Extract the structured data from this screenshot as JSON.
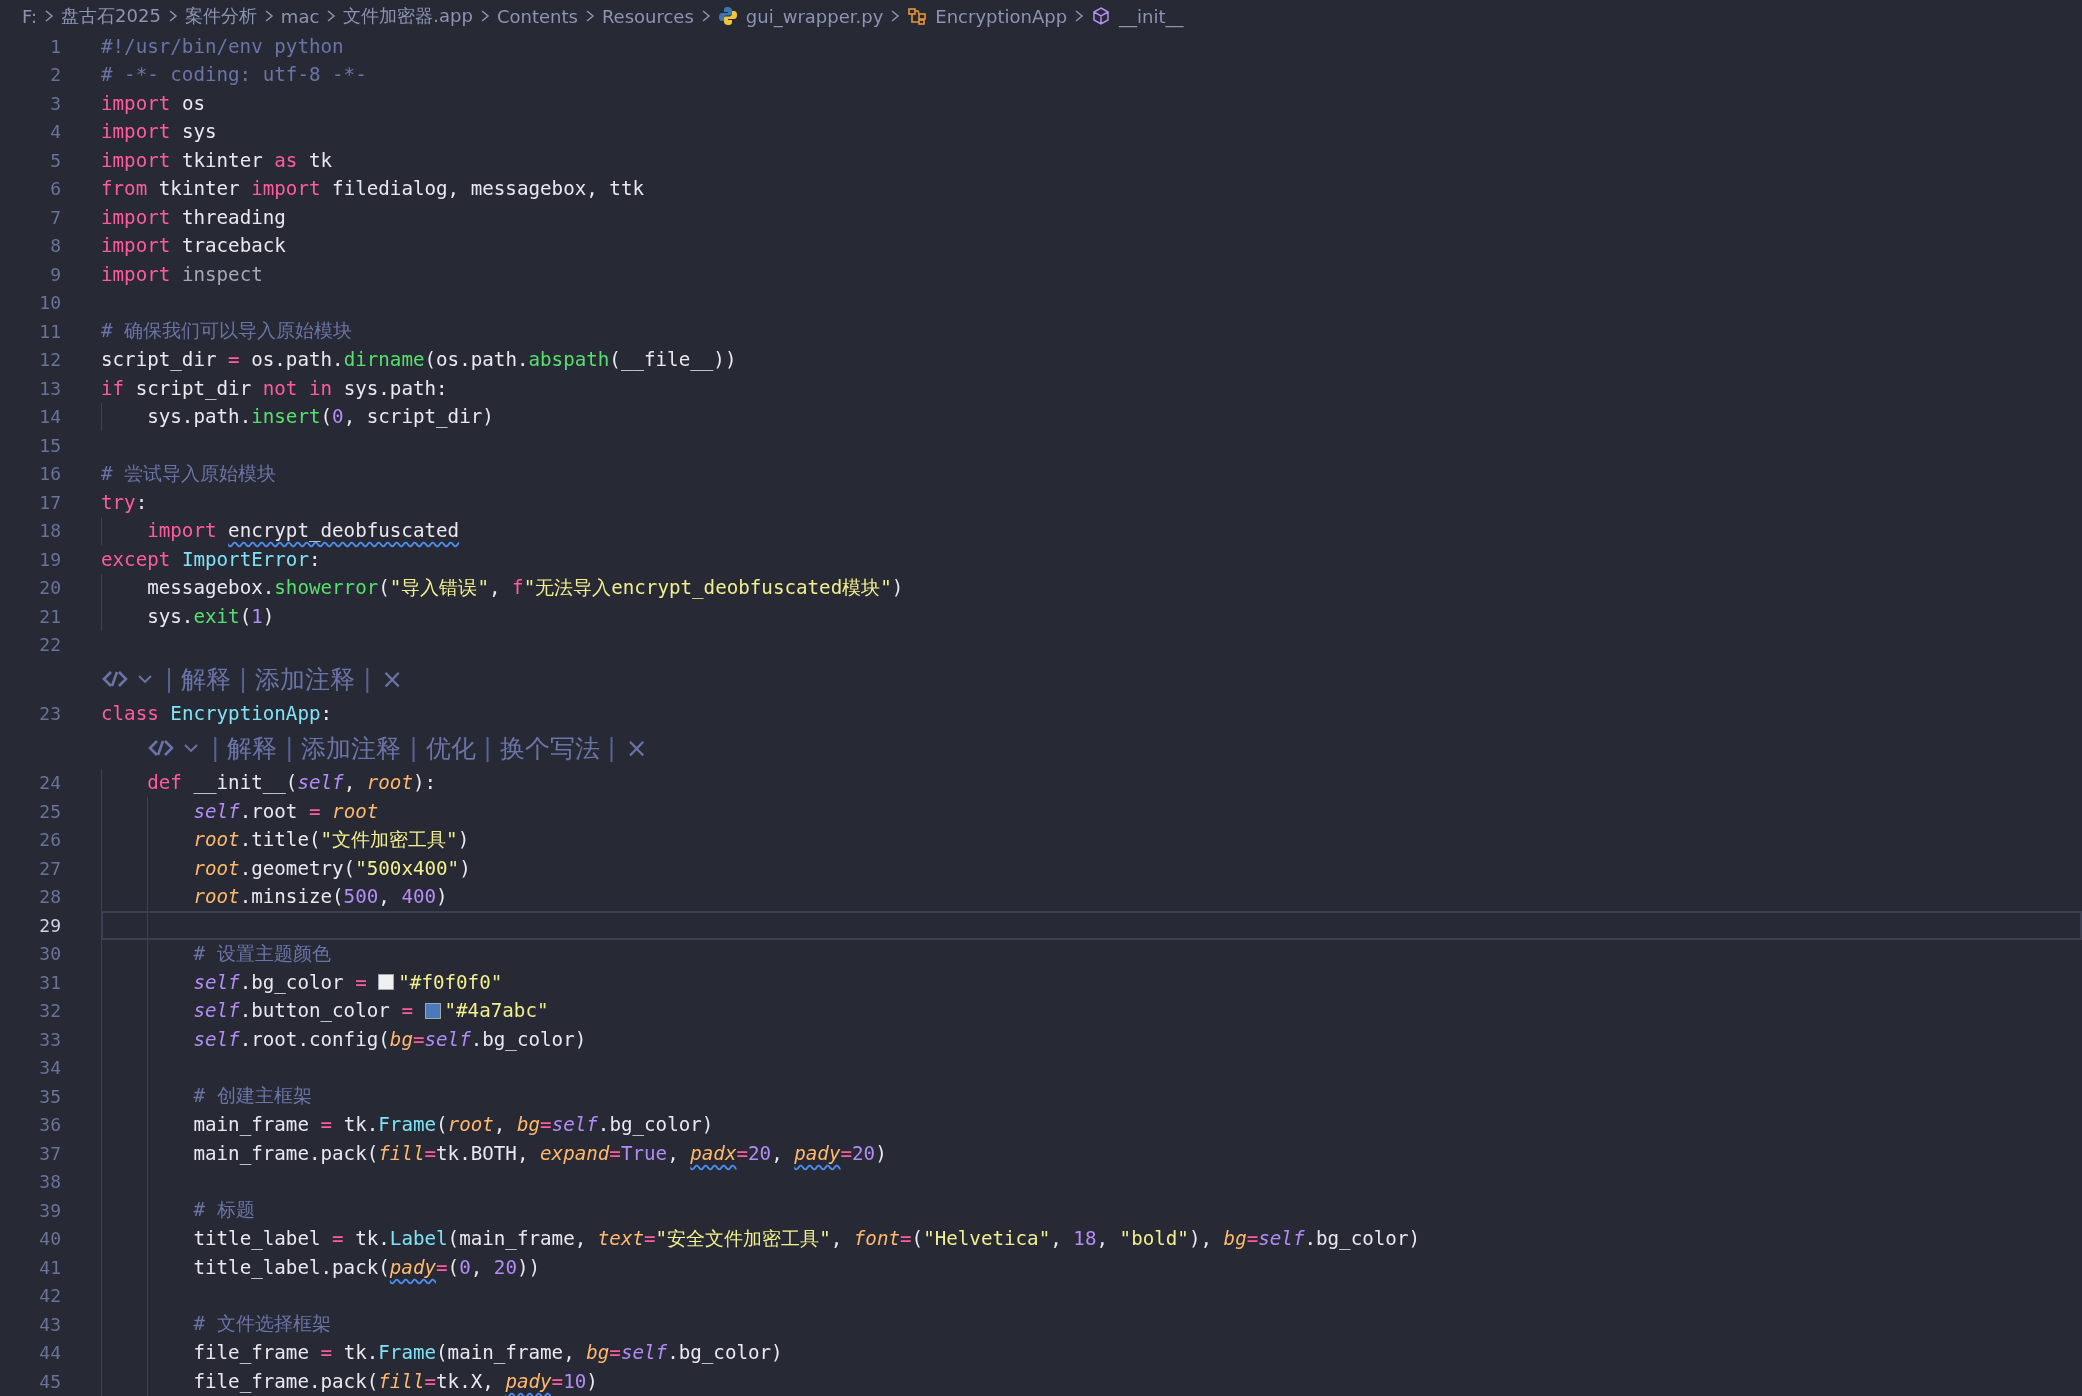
{
  "breadcrumb": [
    {
      "kind": "text",
      "text": "F:"
    },
    {
      "kind": "text",
      "text": "盘古石2025"
    },
    {
      "kind": "text",
      "text": "案件分析"
    },
    {
      "kind": "text",
      "text": "mac"
    },
    {
      "kind": "text",
      "text": "文件加密器.app"
    },
    {
      "kind": "text",
      "text": "Contents"
    },
    {
      "kind": "text",
      "text": "Resources"
    },
    {
      "kind": "python",
      "text": "gui_wrapper.py"
    },
    {
      "kind": "class",
      "text": "EncryptionApp"
    },
    {
      "kind": "method",
      "text": "__init__"
    }
  ],
  "lines": [
    {
      "kind": "code",
      "number": "1",
      "current": false,
      "tokens": [
        {
          "kind": "comment",
          "text": "#!/usr/bin/env python"
        }
      ]
    },
    {
      "kind": "code",
      "number": "2",
      "current": false,
      "tokens": [
        {
          "kind": "comment",
          "text": "# -*- coding: utf-8 -*-"
        }
      ]
    },
    {
      "kind": "code",
      "number": "3",
      "current": false,
      "tokens": [
        {
          "kind": "kw",
          "text": "import"
        },
        {
          "kind": "plain",
          "text": " os"
        }
      ]
    },
    {
      "kind": "code",
      "number": "4",
      "current": false,
      "tokens": [
        {
          "kind": "kw",
          "text": "import"
        },
        {
          "kind": "plain",
          "text": " sys"
        }
      ]
    },
    {
      "kind": "code",
      "number": "5",
      "current": false,
      "tokens": [
        {
          "kind": "kw",
          "text": "import"
        },
        {
          "kind": "plain",
          "text": " tkinter "
        },
        {
          "kind": "kw",
          "text": "as"
        },
        {
          "kind": "plain",
          "text": " tk"
        }
      ]
    },
    {
      "kind": "code",
      "number": "6",
      "current": false,
      "tokens": [
        {
          "kind": "kw",
          "text": "from"
        },
        {
          "kind": "plain",
          "text": " tkinter "
        },
        {
          "kind": "kw",
          "text": "import"
        },
        {
          "kind": "plain",
          "text": " filedialog, messagebox, ttk"
        }
      ]
    },
    {
      "kind": "code",
      "number": "7",
      "current": false,
      "tokens": [
        {
          "kind": "kw",
          "text": "import"
        },
        {
          "kind": "plain",
          "text": " threading"
        }
      ]
    },
    {
      "kind": "code",
      "number": "8",
      "current": false,
      "tokens": [
        {
          "kind": "kw",
          "text": "import"
        },
        {
          "kind": "plain",
          "text": " traceback"
        }
      ]
    },
    {
      "kind": "code",
      "number": "9",
      "current": false,
      "tokens": [
        {
          "kind": "kw",
          "text": "import"
        },
        {
          "kind": "dim",
          "text": " inspect"
        }
      ]
    },
    {
      "kind": "code",
      "number": "10",
      "current": false
    },
    {
      "kind": "code",
      "number": "11",
      "current": false,
      "tokens": [
        {
          "kind": "comment",
          "text": "# 确保我们可以导入原始模块"
        }
      ]
    },
    {
      "kind": "code",
      "number": "12",
      "current": false,
      "tokens": [
        {
          "kind": "plain",
          "text": "script_dir "
        },
        {
          "kind": "kw",
          "text": "="
        },
        {
          "kind": "plain",
          "text": " os.path."
        },
        {
          "kind": "fn",
          "text": "dirname"
        },
        {
          "kind": "plain",
          "text": "(os.path."
        },
        {
          "kind": "fn",
          "text": "abspath"
        },
        {
          "kind": "plain",
          "text": "(__file__))"
        }
      ]
    },
    {
      "kind": "code",
      "number": "13",
      "current": false,
      "tokens": [
        {
          "kind": "kw",
          "text": "if"
        },
        {
          "kind": "plain",
          "text": " script_dir "
        },
        {
          "kind": "kw",
          "text": "not in"
        },
        {
          "kind": "plain",
          "text": " sys.path:"
        }
      ]
    },
    {
      "kind": "code",
      "number": "14",
      "current": false,
      "tokens": [
        {
          "kind": "plain",
          "text": "    sys.path."
        },
        {
          "kind": "fn",
          "text": "insert"
        },
        {
          "kind": "plain",
          "text": "("
        },
        {
          "kind": "num",
          "text": "0"
        },
        {
          "kind": "plain",
          "text": ", script_dir)"
        }
      ]
    },
    {
      "kind": "code",
      "number": "15",
      "current": false
    },
    {
      "kind": "code",
      "number": "16",
      "current": false,
      "tokens": [
        {
          "kind": "comment",
          "text": "# 尝试导入原始模块"
        }
      ]
    },
    {
      "kind": "code",
      "number": "17",
      "current": false,
      "tokens": [
        {
          "kind": "kw",
          "text": "try"
        },
        {
          "kind": "plain",
          "text": ":"
        }
      ]
    },
    {
      "kind": "code",
      "number": "18",
      "current": false,
      "tokens": [
        {
          "kind": "kw",
          "text": "    import "
        },
        {
          "kind": "plain",
          "text": "encrypt_deobfuscated",
          "squiggle": true
        }
      ]
    },
    {
      "kind": "code",
      "number": "19",
      "current": false,
      "tokens": [
        {
          "kind": "kw",
          "text": "except "
        },
        {
          "kind": "cls",
          "text": "ImportError"
        },
        {
          "kind": "plain",
          "text": ":"
        }
      ]
    },
    {
      "kind": "code",
      "number": "20",
      "current": false,
      "tokens": [
        {
          "kind": "plain",
          "text": "    messagebox."
        },
        {
          "kind": "fn",
          "text": "showerror"
        },
        {
          "kind": "plain",
          "text": "("
        },
        {
          "kind": "str",
          "text": "\"导入错误\""
        },
        {
          "kind": "plain",
          "text": ", "
        },
        {
          "kind": "kw",
          "text": "f"
        },
        {
          "kind": "str",
          "text": "\"无法导入encrypt_deobfuscated模块\""
        },
        {
          "kind": "plain",
          "text": ")"
        }
      ]
    },
    {
      "kind": "code",
      "number": "21",
      "current": false,
      "tokens": [
        {
          "kind": "plain",
          "text": "    sys."
        },
        {
          "kind": "fn",
          "text": "exit"
        },
        {
          "kind": "plain",
          "text": "("
        },
        {
          "kind": "num",
          "text": "1"
        },
        {
          "kind": "plain",
          "text": ")"
        }
      ]
    },
    {
      "kind": "code",
      "number": "22",
      "current": false
    },
    {
      "kind": "codelens",
      "parts": [
        {
          "kind": "sep",
          "text": "|"
        },
        {
          "kind": "action",
          "text": "解释"
        },
        {
          "kind": "sep",
          "text": "|"
        },
        {
          "kind": "action",
          "text": "添加注释"
        },
        {
          "kind": "sep",
          "text": "|"
        },
        {
          "kind": "close",
          "text": "×"
        }
      ]
    },
    {
      "kind": "code",
      "number": "23",
      "current": false,
      "tokens": [
        {
          "kind": "kw",
          "text": "class "
        },
        {
          "kind": "cls",
          "text": "EncryptionApp"
        },
        {
          "kind": "plain",
          "text": ":"
        }
      ]
    },
    {
      "kind": "codelens",
      "parts": [
        {
          "kind": "sep",
          "text": "|"
        },
        {
          "kind": "action",
          "text": "解释"
        },
        {
          "kind": "sep",
          "text": "|"
        },
        {
          "kind": "action",
          "text": "添加注释"
        },
        {
          "kind": "sep",
          "text": "|"
        },
        {
          "kind": "action",
          "text": "优化"
        },
        {
          "kind": "sep",
          "text": "|"
        },
        {
          "kind": "action",
          "text": "换个写法"
        },
        {
          "kind": "sep",
          "text": "|"
        },
        {
          "kind": "close",
          "text": "×"
        }
      ]
    },
    {
      "kind": "code",
      "number": "24",
      "current": false,
      "tokens": [
        {
          "kind": "kw",
          "text": "    def"
        },
        {
          "kind": "plain",
          "text": " __init__("
        },
        {
          "kind": "self",
          "text": "self"
        },
        {
          "kind": "plain",
          "text": ", "
        },
        {
          "kind": "param",
          "text": "root"
        },
        {
          "kind": "plain",
          "text": "):"
        }
      ]
    },
    {
      "kind": "code",
      "number": "25",
      "current": false,
      "tokens": [
        {
          "kind": "self",
          "text": "        self"
        },
        {
          "kind": "plain",
          "text": ".root "
        },
        {
          "kind": "kw",
          "text": "= "
        },
        {
          "kind": "param",
          "text": "root"
        }
      ]
    },
    {
      "kind": "code",
      "number": "26",
      "current": false,
      "tokens": [
        {
          "kind": "param",
          "text": "        root"
        },
        {
          "kind": "plain",
          "text": ".title("
        },
        {
          "kind": "str",
          "text": "\"文件加密工具\""
        },
        {
          "kind": "plain",
          "text": ")"
        }
      ]
    },
    {
      "kind": "code",
      "number": "27",
      "current": false,
      "tokens": [
        {
          "kind": "param",
          "text": "        root"
        },
        {
          "kind": "plain",
          "text": ".geometry("
        },
        {
          "kind": "str",
          "text": "\"500x400\""
        },
        {
          "kind": "plain",
          "text": ")"
        }
      ]
    },
    {
      "kind": "code",
      "number": "28",
      "current": false,
      "tokens": [
        {
          "kind": "param",
          "text": "        root"
        },
        {
          "kind": "plain",
          "text": ".minsize("
        },
        {
          "kind": "num",
          "text": "500"
        },
        {
          "kind": "plain",
          "text": ", "
        },
        {
          "kind": "num",
          "text": "400"
        },
        {
          "kind": "plain",
          "text": ")"
        }
      ]
    },
    {
      "kind": "code",
      "number": "29",
      "current": true
    },
    {
      "kind": "code",
      "number": "30",
      "current": false,
      "tokens": [
        {
          "kind": "comment",
          "text": "        # 设置主题颜色"
        }
      ]
    },
    {
      "kind": "code",
      "number": "31",
      "current": false,
      "tokens": [
        {
          "kind": "self",
          "text": "        self"
        },
        {
          "kind": "plain",
          "text": ".bg_color "
        },
        {
          "kind": "kw",
          "text": "= "
        },
        {
          "kind": "swatch",
          "color": "#f0f0f0"
        },
        {
          "kind": "str",
          "text": "\"#f0f0f0\""
        }
      ]
    },
    {
      "kind": "code",
      "number": "32",
      "current": false,
      "tokens": [
        {
          "kind": "self",
          "text": "        self"
        },
        {
          "kind": "plain",
          "text": ".button_color "
        },
        {
          "kind": "kw",
          "text": "= "
        },
        {
          "kind": "swatch",
          "color": "#4a7abc"
        },
        {
          "kind": "str",
          "text": "\"#4a7abc\""
        }
      ]
    },
    {
      "kind": "code",
      "number": "33",
      "current": false,
      "tokens": [
        {
          "kind": "self",
          "text": "        self"
        },
        {
          "kind": "plain",
          "text": ".root.config("
        },
        {
          "kind": "param",
          "text": "bg"
        },
        {
          "kind": "kw",
          "text": "="
        },
        {
          "kind": "self",
          "text": "self"
        },
        {
          "kind": "plain",
          "text": ".bg_color)"
        }
      ]
    },
    {
      "kind": "code",
      "number": "34",
      "current": false
    },
    {
      "kind": "code",
      "number": "35",
      "current": false,
      "tokens": [
        {
          "kind": "comment",
          "text": "        # 创建主框架"
        }
      ]
    },
    {
      "kind": "code",
      "number": "36",
      "current": false,
      "tokens": [
        {
          "kind": "plain",
          "text": "        main_frame "
        },
        {
          "kind": "kw",
          "text": "="
        },
        {
          "kind": "plain",
          "text": " tk."
        },
        {
          "kind": "cls",
          "text": "Frame"
        },
        {
          "kind": "plain",
          "text": "("
        },
        {
          "kind": "param",
          "text": "root"
        },
        {
          "kind": "plain",
          "text": ", "
        },
        {
          "kind": "param",
          "text": "bg"
        },
        {
          "kind": "kw",
          "text": "="
        },
        {
          "kind": "self",
          "text": "self"
        },
        {
          "kind": "plain",
          "text": ".bg_color)"
        }
      ]
    },
    {
      "kind": "code",
      "number": "37",
      "current": false,
      "tokens": [
        {
          "kind": "plain",
          "text": "        main_frame.pack("
        },
        {
          "kind": "param",
          "text": "fill"
        },
        {
          "kind": "kw",
          "text": "="
        },
        {
          "kind": "plain",
          "text": "tk.BOTH, "
        },
        {
          "kind": "param",
          "text": "expand"
        },
        {
          "kind": "kw",
          "text": "="
        },
        {
          "kind": "num",
          "text": "True"
        },
        {
          "kind": "plain",
          "text": ", "
        },
        {
          "kind": "param",
          "text": "padx",
          "squiggle": true
        },
        {
          "kind": "kw",
          "text": "="
        },
        {
          "kind": "num",
          "text": "20"
        },
        {
          "kind": "plain",
          "text": ", "
        },
        {
          "kind": "param",
          "text": "pady",
          "squiggle": true
        },
        {
          "kind": "kw",
          "text": "="
        },
        {
          "kind": "num",
          "text": "20"
        },
        {
          "kind": "plain",
          "text": ")"
        }
      ]
    },
    {
      "kind": "code",
      "number": "38",
      "current": false
    },
    {
      "kind": "code",
      "number": "39",
      "current": false,
      "tokens": [
        {
          "kind": "comment",
          "text": "        # 标题"
        }
      ]
    },
    {
      "kind": "code",
      "number": "40",
      "current": false,
      "tokens": [
        {
          "kind": "plain",
          "text": "        title_label "
        },
        {
          "kind": "kw",
          "text": "="
        },
        {
          "kind": "plain",
          "text": " tk."
        },
        {
          "kind": "cls",
          "text": "Label"
        },
        {
          "kind": "plain",
          "text": "(main_frame, "
        },
        {
          "kind": "param",
          "text": "text"
        },
        {
          "kind": "kw",
          "text": "="
        },
        {
          "kind": "str",
          "text": "\"安全文件加密工具\""
        },
        {
          "kind": "plain",
          "text": ", "
        },
        {
          "kind": "param",
          "text": "font"
        },
        {
          "kind": "kw",
          "text": "="
        },
        {
          "kind": "plain",
          "text": "("
        },
        {
          "kind": "str",
          "text": "\"Helvetica\""
        },
        {
          "kind": "plain",
          "text": ", "
        },
        {
          "kind": "num",
          "text": "18"
        },
        {
          "kind": "plain",
          "text": ", "
        },
        {
          "kind": "str",
          "text": "\"bold\""
        },
        {
          "kind": "plain",
          "text": "), "
        },
        {
          "kind": "param",
          "text": "bg"
        },
        {
          "kind": "kw",
          "text": "="
        },
        {
          "kind": "self",
          "text": "self"
        },
        {
          "kind": "plain",
          "text": ".bg_color)"
        }
      ]
    },
    {
      "kind": "code",
      "number": "41",
      "current": false,
      "tokens": [
        {
          "kind": "plain",
          "text": "        title_label.pack("
        },
        {
          "kind": "param",
          "text": "pady",
          "squiggle": true
        },
        {
          "kind": "kw",
          "text": "="
        },
        {
          "kind": "plain",
          "text": "("
        },
        {
          "kind": "num",
          "text": "0"
        },
        {
          "kind": "plain",
          "text": ", "
        },
        {
          "kind": "num",
          "text": "20"
        },
        {
          "kind": "plain",
          "text": "))"
        }
      ]
    },
    {
      "kind": "code",
      "number": "42",
      "current": false
    },
    {
      "kind": "code",
      "number": "43",
      "current": false,
      "tokens": [
        {
          "kind": "comment",
          "text": "        # 文件选择框架"
        }
      ]
    },
    {
      "kind": "code",
      "number": "44",
      "current": false,
      "tokens": [
        {
          "kind": "plain",
          "text": "        file_frame "
        },
        {
          "kind": "kw",
          "text": "="
        },
        {
          "kind": "plain",
          "text": " tk."
        },
        {
          "kind": "cls",
          "text": "Frame"
        },
        {
          "kind": "plain",
          "text": "(main_frame, "
        },
        {
          "kind": "param",
          "text": "bg"
        },
        {
          "kind": "kw",
          "text": "="
        },
        {
          "kind": "self",
          "text": "self"
        },
        {
          "kind": "plain",
          "text": ".bg_color)"
        }
      ]
    },
    {
      "kind": "code",
      "number": "45",
      "current": false,
      "tokens": [
        {
          "kind": "plain",
          "text": "        file_frame.pack("
        },
        {
          "kind": "param",
          "text": "fill"
        },
        {
          "kind": "kw",
          "text": "="
        },
        {
          "kind": "plain",
          "text": "tk.X, "
        },
        {
          "kind": "param",
          "text": "pady",
          "squiggle": true
        },
        {
          "kind": "kw",
          "text": "="
        },
        {
          "kind": "num",
          "text": "10"
        },
        {
          "kind": "plain",
          "text": ")"
        }
      ]
    }
  ]
}
